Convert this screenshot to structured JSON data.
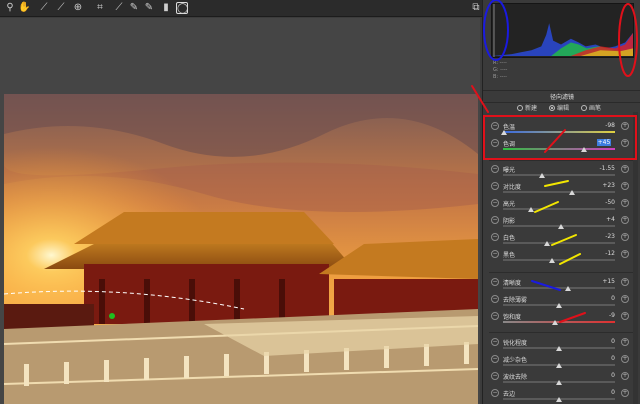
{
  "toolbar": {
    "tools": [
      {
        "icon": "zoom-icon",
        "glyph": "⚲"
      },
      {
        "icon": "hand-icon",
        "glyph": "✋"
      },
      {
        "icon": "eyedropper-icon",
        "glyph": "⟋"
      },
      {
        "icon": "color-sampler-icon",
        "glyph": "⟋"
      },
      {
        "icon": "target-adjust-icon",
        "glyph": "⊕"
      },
      {
        "icon": "crop-icon",
        "glyph": "⌗"
      },
      {
        "icon": "straighten-icon",
        "glyph": "⟋"
      },
      {
        "icon": "spot-removal-icon",
        "glyph": "✎"
      },
      {
        "icon": "brush-icon",
        "glyph": "✎"
      },
      {
        "icon": "graduated-filter-icon",
        "glyph": "▮"
      },
      {
        "icon": "radial-filter-icon",
        "glyph": "◯"
      }
    ],
    "right_icon": "fullscreen-icon"
  },
  "histogram": {
    "readouts": [
      "R: ----",
      "G: ----",
      "B: ----"
    ]
  },
  "panel": {
    "title": "径向滤镜",
    "modes": [
      {
        "label": "新建",
        "selected": false
      },
      {
        "label": "编辑",
        "selected": true
      },
      {
        "label": "画笔",
        "selected": false
      }
    ],
    "sliders": [
      {
        "label": "色温",
        "value": "-98",
        "level": 0.01,
        "selected": false
      },
      {
        "label": "色调",
        "value": "+45",
        "level": 0.72,
        "selected": true
      },
      {
        "label": "曝光",
        "value": "-1.55",
        "level": 0.35,
        "selected": false
      },
      {
        "label": "对比度",
        "value": "+23",
        "level": 0.62,
        "selected": false
      },
      {
        "label": "高光",
        "value": "-50",
        "level": 0.25,
        "selected": false
      },
      {
        "label": "阴影",
        "value": "+4",
        "level": 0.52,
        "selected": false
      },
      {
        "label": "白色",
        "value": "-23",
        "level": 0.39,
        "selected": false
      },
      {
        "label": "黑色",
        "value": "-12",
        "level": 0.44,
        "selected": false
      },
      {
        "label": "清晰度",
        "value": "+15",
        "level": 0.58,
        "selected": false
      },
      {
        "label": "去除薄雾",
        "value": "0",
        "level": 0.5,
        "selected": false
      },
      {
        "label": "饱和度",
        "value": "-9",
        "level": 0.46,
        "selected": false
      },
      {
        "label": "锐化程度",
        "value": "0",
        "level": 0.5,
        "selected": false
      },
      {
        "label": "减少杂色",
        "value": "0",
        "level": 0.5,
        "selected": false
      },
      {
        "label": "波纹去除",
        "value": "0",
        "level": 0.5,
        "selected": false
      },
      {
        "label": "去边",
        "value": "0",
        "level": 0.5,
        "selected": false
      }
    ]
  },
  "colors": {
    "selection_blue": "#3d7de0",
    "annotation_red": "#e0101a",
    "annotation_blue": "#1a1ae0",
    "annotation_yellow": "#f2e600"
  }
}
